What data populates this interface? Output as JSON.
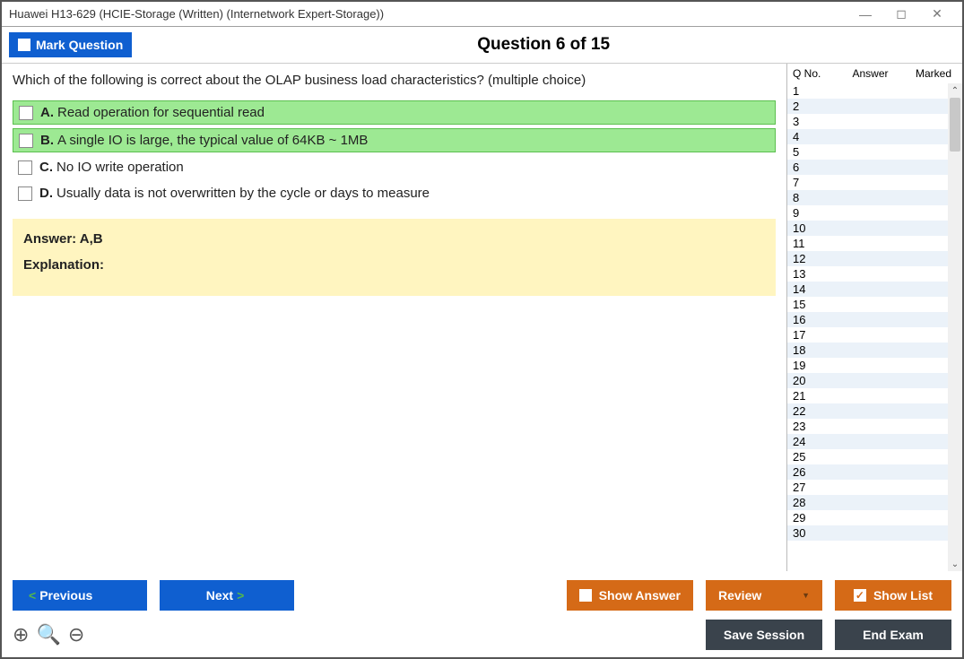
{
  "window": {
    "title": "Huawei H13-629 (HCIE-Storage (Written) (Internetwork Expert-Storage))"
  },
  "topbar": {
    "mark_label": "Mark Question",
    "question_header": "Question 6 of 15"
  },
  "question": {
    "text": "Which of the following is correct about the OLAP business load characteristics? (multiple choice)",
    "options": [
      {
        "letter": "A.",
        "text": "Read operation for sequential read",
        "correct": true
      },
      {
        "letter": "B.",
        "text": "A single IO is large, the typical value of 64KB ~ 1MB",
        "correct": true
      },
      {
        "letter": "C.",
        "text": "No IO write operation",
        "correct": false
      },
      {
        "letter": "D.",
        "text": "Usually data is not overwritten by the cycle or days to measure",
        "correct": false
      }
    ]
  },
  "answer_panel": {
    "answer_label": "Answer: A,B",
    "explanation_label": "Explanation:"
  },
  "sidebar": {
    "headers": {
      "qno": "Q No.",
      "answer": "Answer",
      "marked": "Marked"
    },
    "rows": [
      1,
      2,
      3,
      4,
      5,
      6,
      7,
      8,
      9,
      10,
      11,
      12,
      13,
      14,
      15,
      16,
      17,
      18,
      19,
      20,
      21,
      22,
      23,
      24,
      25,
      26,
      27,
      28,
      29,
      30
    ]
  },
  "footer": {
    "previous": "Previous",
    "next": "Next",
    "show_answer": "Show Answer",
    "review": "Review",
    "show_list": "Show List",
    "save_session": "Save Session",
    "end_exam": "End Exam"
  }
}
